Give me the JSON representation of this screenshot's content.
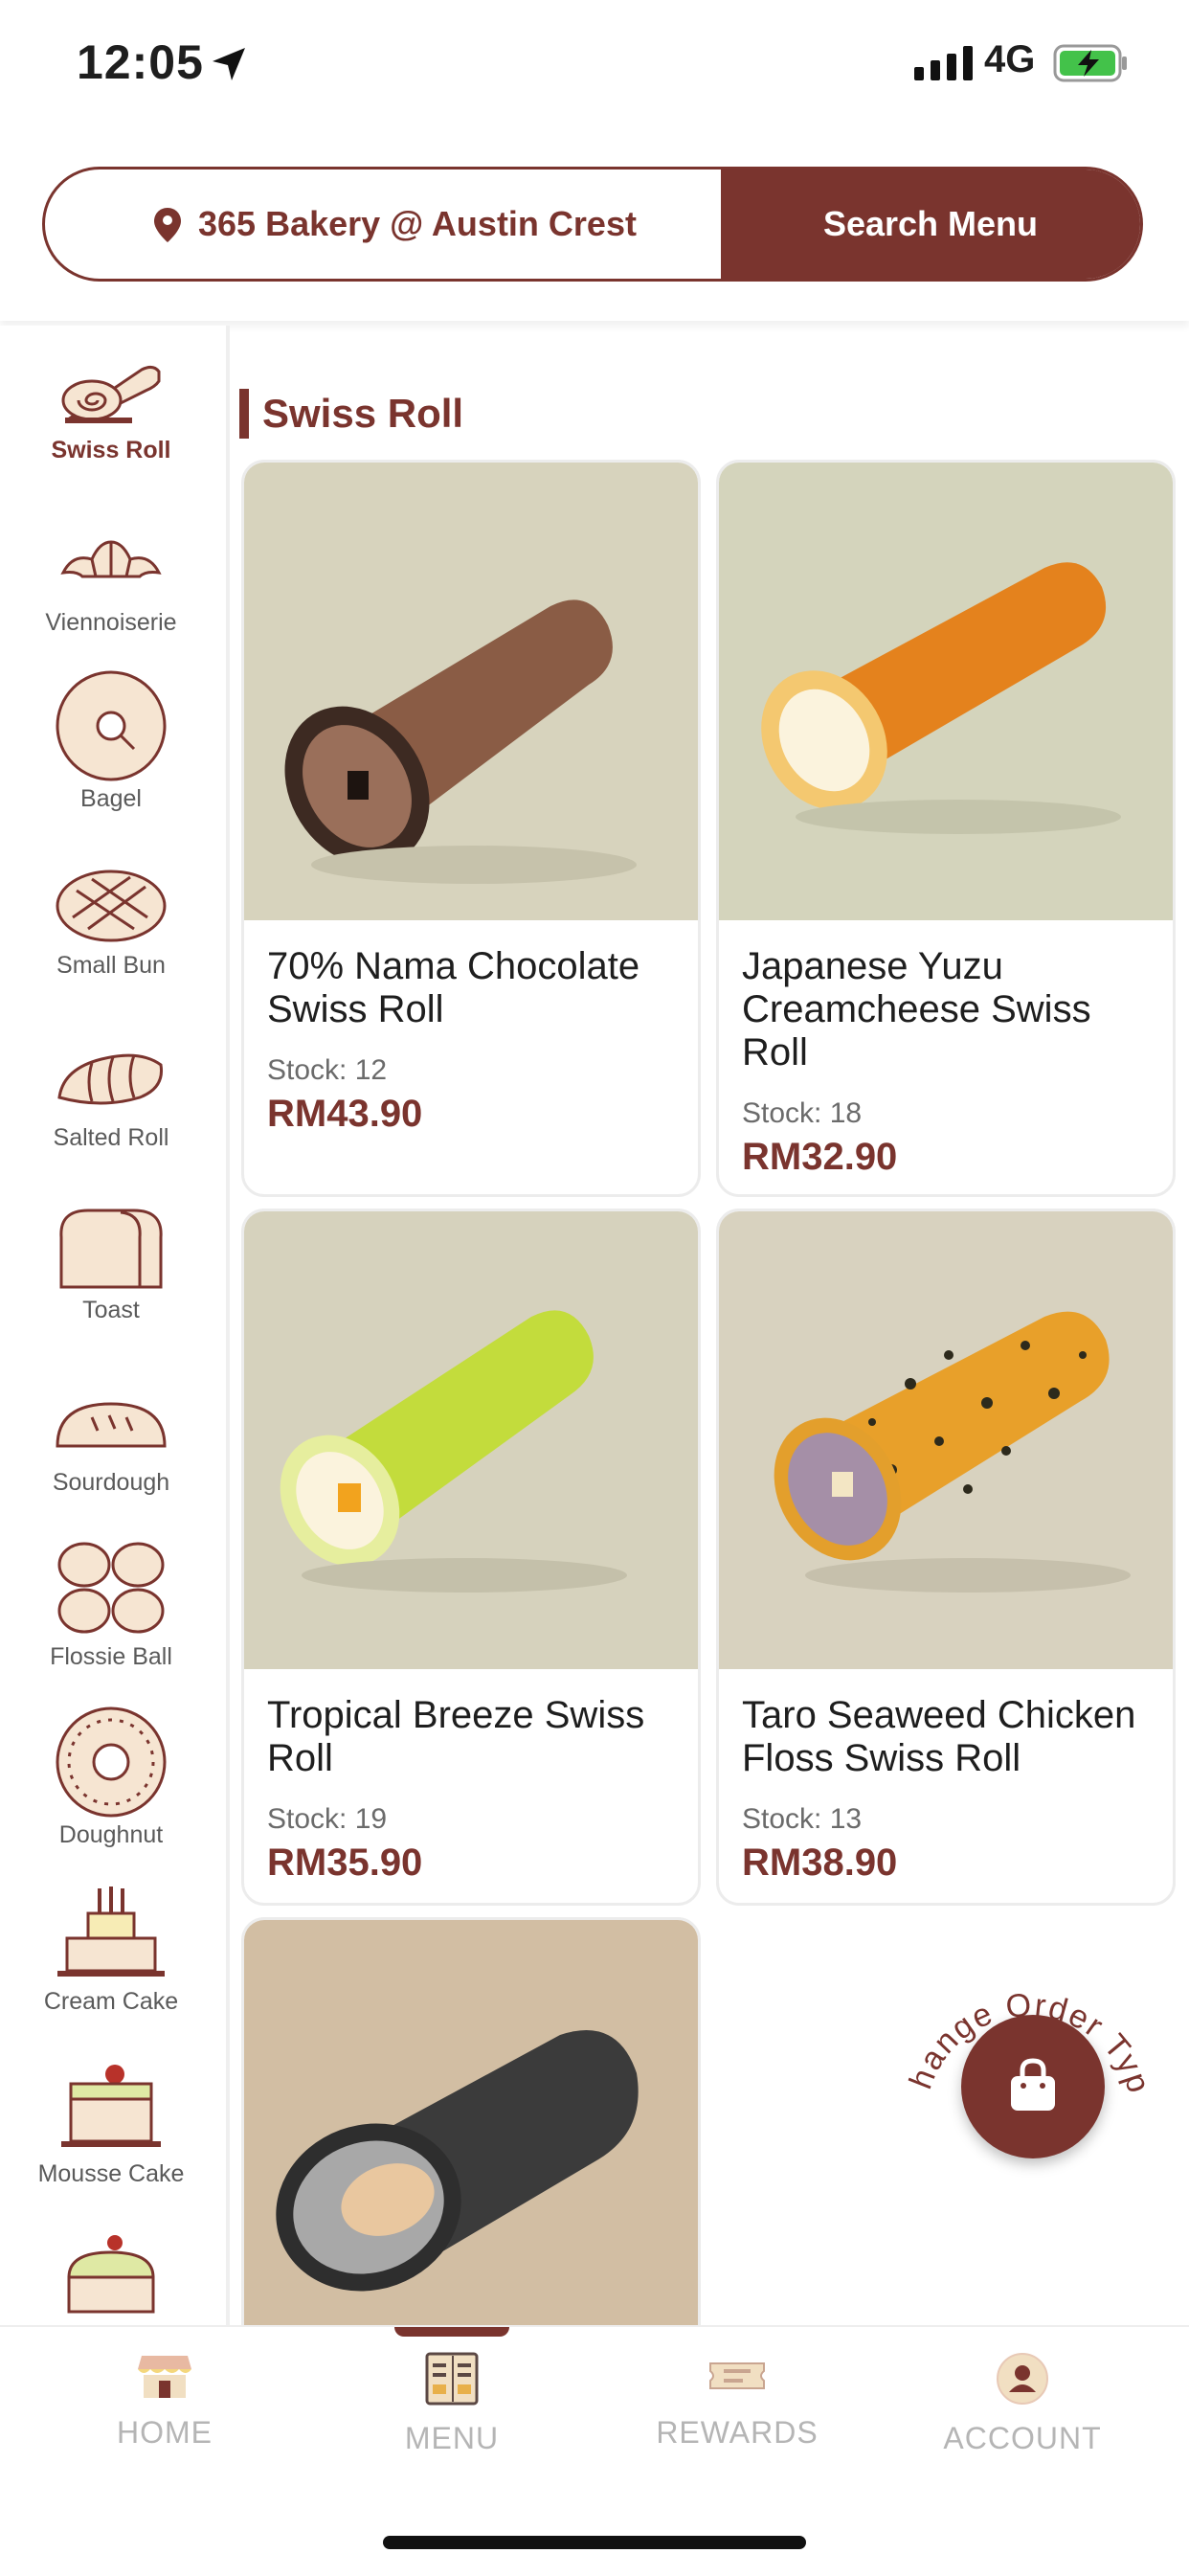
{
  "status_bar": {
    "time": "12:05",
    "network": "4G"
  },
  "header": {
    "store_name": "365 Bakery @ Austin Crest",
    "search_label": "Search Menu"
  },
  "sidebar": {
    "items": [
      {
        "label": "Swiss Roll",
        "icon": "swiss-roll-icon",
        "active": true
      },
      {
        "label": "Viennoiserie",
        "icon": "croissant-icon"
      },
      {
        "label": "Bagel",
        "icon": "bagel-icon"
      },
      {
        "label": "Small Bun",
        "icon": "bun-icon"
      },
      {
        "label": "Salted Roll",
        "icon": "salted-roll-icon"
      },
      {
        "label": "Toast",
        "icon": "toast-icon"
      },
      {
        "label": "Sourdough",
        "icon": "sourdough-icon"
      },
      {
        "label": "Flossie Ball",
        "icon": "flossie-ball-icon"
      },
      {
        "label": "Doughnut",
        "icon": "doughnut-icon"
      },
      {
        "label": "Cream Cake",
        "icon": "cream-cake-icon"
      },
      {
        "label": "Mousse Cake",
        "icon": "mousse-cake-icon"
      }
    ]
  },
  "section": {
    "title": "Swiss Roll"
  },
  "products": [
    {
      "name": "70% Nama Chocolate Swiss Roll",
      "stock": "Stock: 12",
      "price": "RM43.90"
    },
    {
      "name": "Japanese Yuzu Creamcheese Swiss Roll",
      "stock": "Stock: 18",
      "price": "RM32.90"
    },
    {
      "name": "Tropical Breeze Swiss Roll",
      "stock": "Stock: 19",
      "price": "RM35.90"
    },
    {
      "name": "Taro Seaweed Chicken Floss Swiss Roll",
      "stock": "Stock: 13",
      "price": "RM38.90"
    }
  ],
  "fab": {
    "label": "Change Order Type"
  },
  "bottom_nav": {
    "items": [
      {
        "label": "HOME",
        "icon": "store-icon"
      },
      {
        "label": "MENU",
        "icon": "menu-book-icon",
        "active": true
      },
      {
        "label": "REWARDS",
        "icon": "ticket-icon"
      },
      {
        "label": "ACCOUNT",
        "icon": "user-icon"
      }
    ]
  },
  "colors": {
    "brand": "#7a342e",
    "icon_fill": "#f6e5d2"
  }
}
